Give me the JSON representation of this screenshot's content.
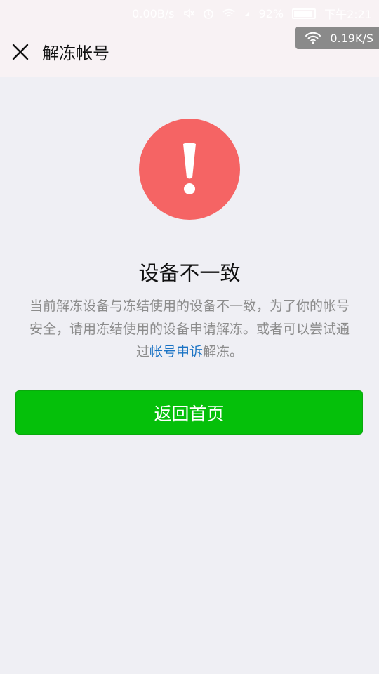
{
  "status_bar": {
    "net_speed": "0.00B/s",
    "battery": "92%",
    "time": "下午2:21"
  },
  "nav": {
    "close_icon": "close-icon",
    "title": "解冻帐号"
  },
  "speed_toast": {
    "icon": "wifi-icon",
    "text": "0.19K/S"
  },
  "alert": {
    "icon": "exclamation-icon",
    "color": "#f56464"
  },
  "main": {
    "headline": "设备不一致",
    "description_before": "当前解冻设备与冻结使用的设备不一致，为了你的帐号安全，请用冻结使用的设备申请解冻。或者可以尝试通过",
    "description_link": "帐号申诉",
    "description_after": "解冻。",
    "button_label": "返回首页"
  },
  "colors": {
    "primary_button": "#05c00a",
    "link": "#1a73c4",
    "background": "#efeff4"
  }
}
